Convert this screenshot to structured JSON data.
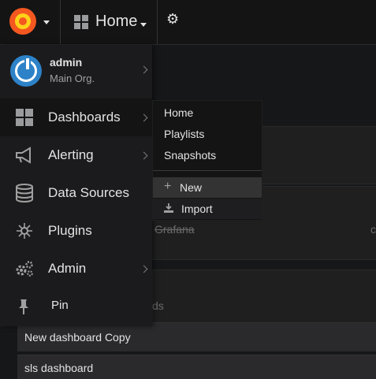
{
  "navbar": {
    "dashboard_title": "Home"
  },
  "background": {
    "strike_text": "Grafana",
    "faded_text": "ds",
    "edge_glyph": "c",
    "rows": [
      "New dashboard Copy",
      "sls dashboard"
    ]
  },
  "sidemenu": {
    "user": {
      "name": "admin",
      "org": "Main Org."
    },
    "items": [
      {
        "label": "Dashboards",
        "icon": "dashboards-grid-icon",
        "has_submenu": true,
        "active": true
      },
      {
        "label": "Alerting",
        "icon": "megaphone-icon",
        "has_submenu": true
      },
      {
        "label": "Data Sources",
        "icon": "database-icon",
        "has_submenu": false
      },
      {
        "label": "Plugins",
        "icon": "plugins-icon",
        "has_submenu": false
      },
      {
        "label": "Admin",
        "icon": "gears-icon",
        "has_submenu": true
      },
      {
        "label": "Pin",
        "icon": "pin-icon",
        "has_submenu": false
      }
    ]
  },
  "dashboards_submenu": {
    "items": [
      {
        "label": "Home"
      },
      {
        "label": "Playlists"
      },
      {
        "label": "Snapshots"
      }
    ],
    "actions": [
      {
        "label": "New",
        "icon": "plus-icon",
        "highlighted": true
      },
      {
        "label": "Import",
        "icon": "download-icon"
      }
    ]
  },
  "colors": {
    "brand_orange": "#f4571f",
    "brand_yellow": "#ffd21a",
    "avatar_blue": "#2d82c8",
    "menu_bg": "#1b1b1d",
    "page_bg": "#161719"
  }
}
